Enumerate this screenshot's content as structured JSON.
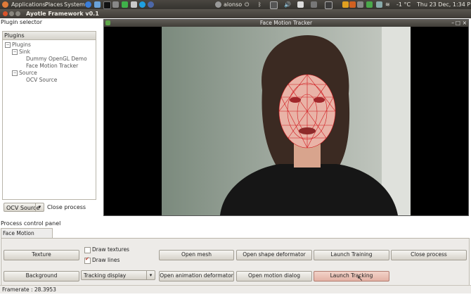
{
  "panel": {
    "menus": [
      "Applications",
      "Places",
      "System"
    ],
    "user": "alonso",
    "temperature": "-1 °C",
    "datetime": "Thu 23 Dec, 1:34 PM"
  },
  "window": {
    "title": "Ayotle Framework v0.1"
  },
  "plugin_selector": {
    "label": "Plugin selector",
    "tree_header": "Plugins",
    "tree": {
      "root": "Plugins",
      "sink": "Sink",
      "sink_children": [
        "Dummy OpenGL Demo",
        "Face Motion Tracker"
      ],
      "source": "Source",
      "source_children": [
        "OCV Source"
      ]
    },
    "source_combo_value": "OCV Source",
    "close_process": "Close process"
  },
  "video": {
    "title": "Face Motion Tracker"
  },
  "process_panel": {
    "label": "Process control panel",
    "tab": "Face Motion Tracker",
    "row1": {
      "texture": "Texture",
      "draw_textures": "Draw textures",
      "open_mesh": "Open mesh",
      "open_shape_deformator": "Open shape deformator",
      "launch_training": "Launch Training",
      "close_process": "Close process"
    },
    "row2": {
      "background": "Background",
      "tracking_display": "Tracking display",
      "open_animation_deformator": "Open animation deformator",
      "open_motion_dialog": "Open motion dialog",
      "launch_tracking": "Launch Tracking"
    },
    "draw_lines": "Draw lines",
    "draw_textures_checked": false,
    "draw_lines_checked": true
  },
  "status": {
    "framerate": "Framerate : 28.3953"
  }
}
